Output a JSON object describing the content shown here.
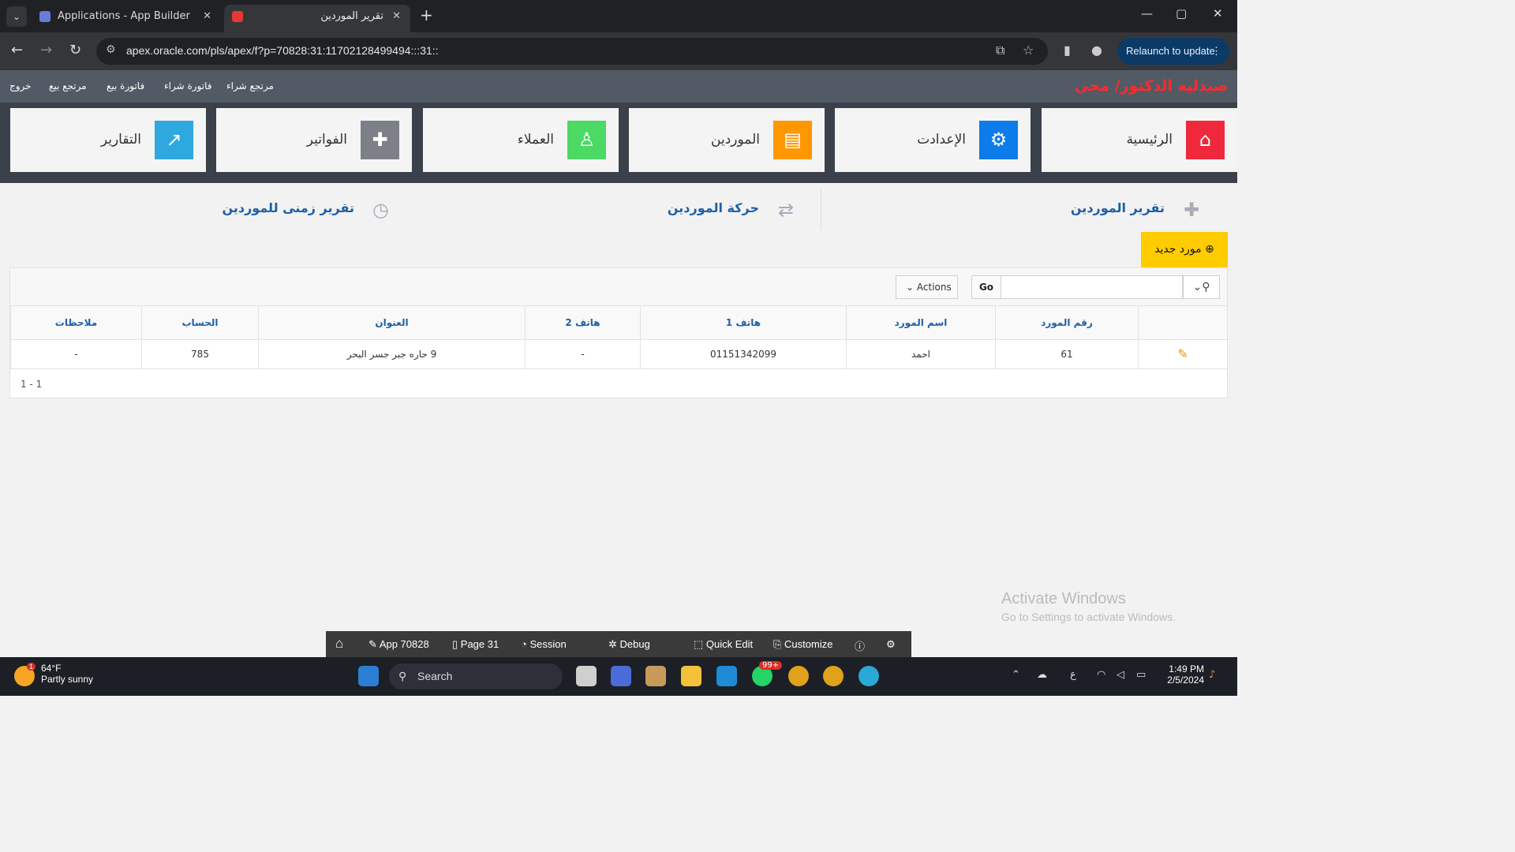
{
  "browser": {
    "tabs": [
      {
        "title": "Applications - App Builder"
      },
      {
        "title": "تقرير الموردين"
      }
    ],
    "url": "apex.oracle.com/pls/apex/f?p=70828:31:11702128499494:::31::",
    "relaunch_label": "Relaunch to update"
  },
  "app": {
    "brand": "صيدليه الدكتور/ محي",
    "menu": [
      "خروج",
      "مرتجع بيع",
      "فاتورة بيع",
      "فاتورة شراء",
      "مرتجع شراء"
    ]
  },
  "cards": [
    {
      "label": "الرئيسية",
      "icon": "home-icon",
      "color": "#f0283c"
    },
    {
      "label": "الإعدادت",
      "icon": "gear-icon",
      "color": "#0d7bea"
    },
    {
      "label": "الموردين",
      "icon": "bus-icon",
      "color": "#ff9800"
    },
    {
      "label": "العملاء",
      "icon": "person-icon",
      "color": "#4cd964"
    },
    {
      "label": "الفواتير",
      "icon": "ambulance-icon",
      "color": "#7d8088"
    },
    {
      "label": "التقارير",
      "icon": "chart-line-icon",
      "color": "#2fa8e0"
    }
  ],
  "links": [
    {
      "label": "تقرير الموردين",
      "icon": "ambulance-icon"
    },
    {
      "label": "حركة الموردين",
      "icon": "swap-arrows-icon"
    },
    {
      "label": "تقرير زمنى للموردين",
      "icon": "clock-history-icon"
    }
  ],
  "new_supplier_label": "مورد جديد",
  "report": {
    "actions_label": "Actions",
    "go_label": "Go",
    "search_value": "",
    "columns": [
      "رقم المورد",
      "اسم المورد",
      "هاتف 1",
      "هاتف 2",
      "العنوان",
      "الحساب",
      "ملاحظات"
    ],
    "rows": [
      {
        "id": "61",
        "name": "احمد",
        "phone1": "01151342099",
        "phone2": "-",
        "address": "9 حاره جبر جسر البحر",
        "account": "785",
        "notes": "-"
      }
    ],
    "pagination": "1 - 1"
  },
  "activate": {
    "line1": "Activate Windows",
    "line2": "Go to Settings to activate Windows."
  },
  "devbar": {
    "app": "App 70828",
    "page": "Page 31",
    "session": "Session",
    "debug": "Debug",
    "quick_edit": "Quick Edit",
    "customize": "Customize"
  },
  "taskbar": {
    "temp": "64°F",
    "weather": "Partly sunny",
    "weather_badge": "1",
    "search": "Search",
    "whatsapp_badge": "99+",
    "time": "1:49 PM",
    "date": "2/5/2024",
    "lang": "ع"
  }
}
